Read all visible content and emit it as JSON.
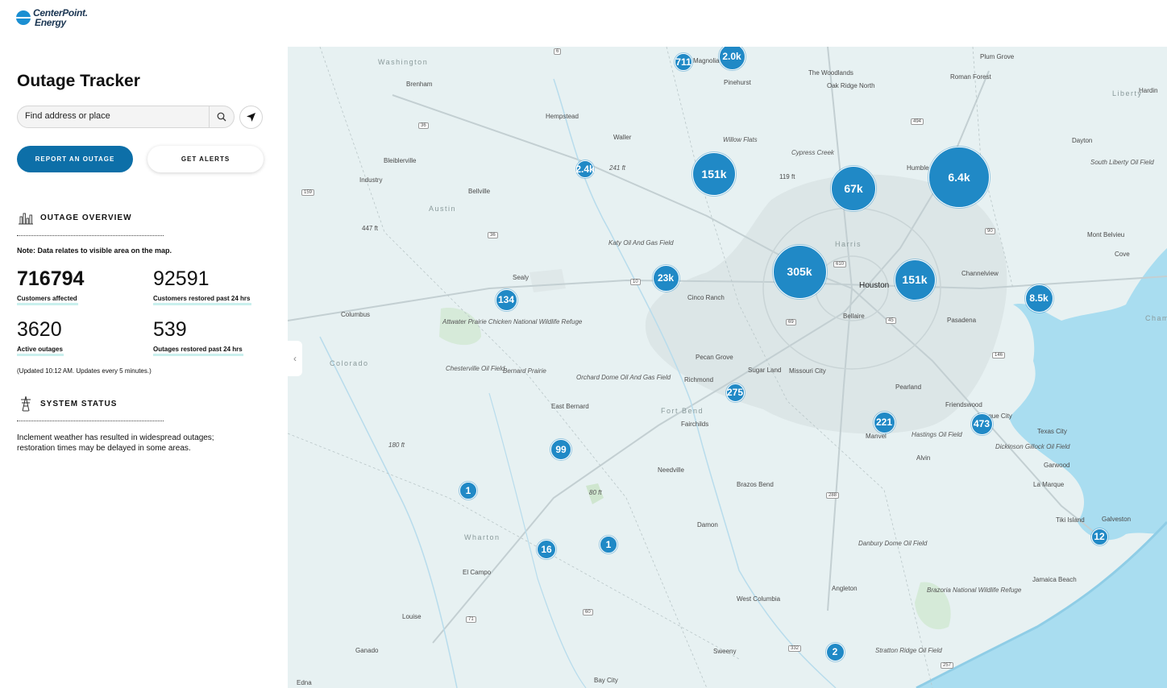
{
  "brand": {
    "line1": "CenterPoint.",
    "line2": "Energy"
  },
  "panel": {
    "title": "Outage Tracker",
    "search_placeholder": "Find address or place",
    "report_label": "REPORT AN OUTAGE",
    "alerts_label": "GET ALERTS",
    "overview_heading": "OUTAGE OVERVIEW",
    "note": "Note: Data relates to visible area on the map.",
    "stats": {
      "customers_affected": {
        "value": "716794",
        "label": "Customers affected"
      },
      "customers_restored": {
        "value": "92591",
        "label": "Customers restored past 24 hrs"
      },
      "active_outages": {
        "value": "3620",
        "label": "Active outages"
      },
      "outages_restored": {
        "value": "539",
        "label": "Outages restored past 24 hrs"
      }
    },
    "updated": "(Updated 10:12 AM. Updates every 5 minutes.)",
    "status_heading": "SYSTEM STATUS",
    "status_text": "Inclement weather has resulted in widespread outages; restoration times may be delayed in some areas."
  },
  "map": {
    "colors": {
      "water": "#a9ddf0",
      "land": "#e7f1f2",
      "urban": "#dde6e7",
      "cluster": "#2089c6"
    },
    "places": [
      "Washington",
      "Brenham",
      "Hempstead",
      "Waller",
      "Magnolia",
      "Pinehurst",
      "The Woodlands",
      "Oak Ridge North",
      "Plum Grove",
      "Roman Forest",
      "Hardin",
      "Liberty",
      "Dayton",
      "Humble",
      "Willow Flats",
      "Cypress Creek",
      "119 ft",
      "Bleiblerville",
      "Industry",
      "Bellville",
      "Austin",
      "447 ft",
      "Katy Oil And Gas Field",
      "Harris",
      "Houston",
      "Channelview",
      "Mont Belvieu",
      "Cove",
      "Sealy",
      "Cinco Ranch",
      "Bellaire",
      "Pasadena",
      "Columbus",
      "Attwater Prairie Chicken National Wildlife Refuge",
      "Colorado",
      "Chesterville Oil Field",
      "Bernard Prairie",
      "Orchard Dome Oil And Gas Field",
      "Pecan Grove",
      "Sugar Land",
      "Missouri City",
      "Richmond",
      "East Bernard",
      "Fort Bend",
      "Pearland",
      "Friendswood",
      "Manvel",
      "Hastings Oil Field",
      "Alvin",
      "Dickinson Gillock Oil Field",
      "Garwood",
      "180 ft",
      "Fairchilds",
      "Needville",
      "Brazos Bend",
      "League City",
      "La Marque",
      "Wharton",
      "Damon",
      "Texas City",
      "Tiki Island",
      "Galveston",
      "Jamaica Beach",
      "El Campo",
      "Danbury Dome Oil Field",
      "Angleton",
      "West Columbia",
      "Brazoria National Wildlife Refuge",
      "Louise",
      "Ganado",
      "Sweeny",
      "Stratton Ridge Oil Field",
      "Bay City",
      "Edna",
      "South Liberty Oil Field",
      "241 ft",
      "80 ft",
      "Cham"
    ],
    "clusters": [
      {
        "label": "711",
        "value": 711
      },
      {
        "label": "2.0k",
        "value": 2000
      },
      {
        "label": "2.4k",
        "value": 2400
      },
      {
        "label": "151k",
        "value": 151000
      },
      {
        "label": "67k",
        "value": 67000
      },
      {
        "label": "6.4k",
        "value": 6400
      },
      {
        "label": "305k",
        "value": 305000
      },
      {
        "label": "151k",
        "value": 151000
      },
      {
        "label": "23k",
        "value": 23000
      },
      {
        "label": "134",
        "value": 134
      },
      {
        "label": "8.5k",
        "value": 8500
      },
      {
        "label": "275",
        "value": 275
      },
      {
        "label": "221",
        "value": 221
      },
      {
        "label": "473",
        "value": 473
      },
      {
        "label": "99",
        "value": 99
      },
      {
        "label": "1",
        "value": 1
      },
      {
        "label": "16",
        "value": 16
      },
      {
        "label": "1",
        "value": 1
      },
      {
        "label": "12",
        "value": 12
      },
      {
        "label": "2",
        "value": 2
      }
    ],
    "highway_shields": [
      "6",
      "36",
      "494",
      "159",
      "36",
      "90",
      "10",
      "610",
      "69",
      "45",
      "146",
      "288",
      "71",
      "60",
      "332",
      "257"
    ]
  }
}
